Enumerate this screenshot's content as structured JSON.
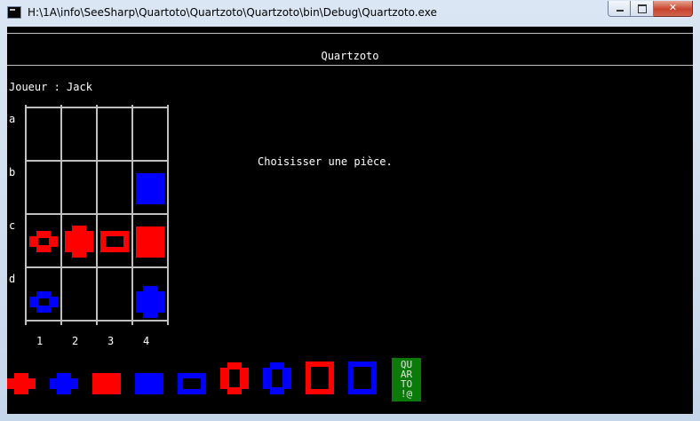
{
  "window": {
    "title": "H:\\1A\\info\\SeeSharp\\Quartoto\\Quartzoto\\Quartzoto\\bin\\Debug\\Quartzoto.exe"
  },
  "game": {
    "title": "Quartzoto",
    "player_line": "Joueur : Jack",
    "prompt": "Choisisser une pièce.",
    "rows": [
      "a",
      "b",
      "c",
      "d"
    ],
    "columns": [
      "1",
      "2",
      "3",
      "4"
    ]
  },
  "colors": {
    "red": "#ff0000",
    "blue": "#0000ff",
    "grid": "#c0c0c0",
    "background": "#000000",
    "logo_bg": "#0b7a0b"
  },
  "board_pieces": [
    {
      "row": "b",
      "col": "4",
      "color": "blue",
      "shape": "square-filled-large",
      "icon": "blue-large-solid-square-piece-icon"
    },
    {
      "row": "c",
      "col": "1",
      "color": "red",
      "shape": "round-hollow-small",
      "icon": "red-small-hollow-round-piece-icon"
    },
    {
      "row": "c",
      "col": "2",
      "color": "red",
      "shape": "round-filled-large",
      "icon": "red-large-solid-round-piece-icon"
    },
    {
      "row": "c",
      "col": "3",
      "color": "red",
      "shape": "square-hollow-small",
      "icon": "red-small-hollow-square-piece-icon"
    },
    {
      "row": "c",
      "col": "4",
      "color": "red",
      "shape": "square-filled-large",
      "icon": "red-large-solid-square-piece-icon"
    },
    {
      "row": "d",
      "col": "1",
      "color": "blue",
      "shape": "round-hollow-small",
      "icon": "blue-small-hollow-round-piece-icon"
    },
    {
      "row": "d",
      "col": "4",
      "color": "blue",
      "shape": "round-filled-large",
      "icon": "blue-large-solid-round-piece-icon"
    }
  ],
  "available_pieces": [
    {
      "color": "red",
      "shape": "round-filled-small",
      "icon": "red-small-solid-round-piece-icon"
    },
    {
      "color": "blue",
      "shape": "round-filled-small",
      "icon": "blue-small-solid-round-piece-icon"
    },
    {
      "color": "red",
      "shape": "square-filled-small",
      "icon": "red-small-solid-square-piece-icon"
    },
    {
      "color": "blue",
      "shape": "square-filled-small",
      "icon": "blue-small-solid-square-piece-icon"
    },
    {
      "color": "blue",
      "shape": "square-hollow-small",
      "icon": "blue-small-hollow-square-piece-icon"
    },
    {
      "color": "red",
      "shape": "round-hollow-large",
      "icon": "red-large-hollow-round-piece-icon"
    },
    {
      "color": "blue",
      "shape": "round-hollow-large",
      "icon": "blue-large-hollow-round-piece-icon"
    },
    {
      "color": "red",
      "shape": "square-hollow-large",
      "icon": "red-large-hollow-square-piece-icon"
    },
    {
      "color": "blue",
      "shape": "square-hollow-large",
      "icon": "blue-large-hollow-square-piece-icon"
    }
  ],
  "logo": {
    "lines": [
      "QU",
      "AR",
      "TO",
      "!@"
    ]
  }
}
